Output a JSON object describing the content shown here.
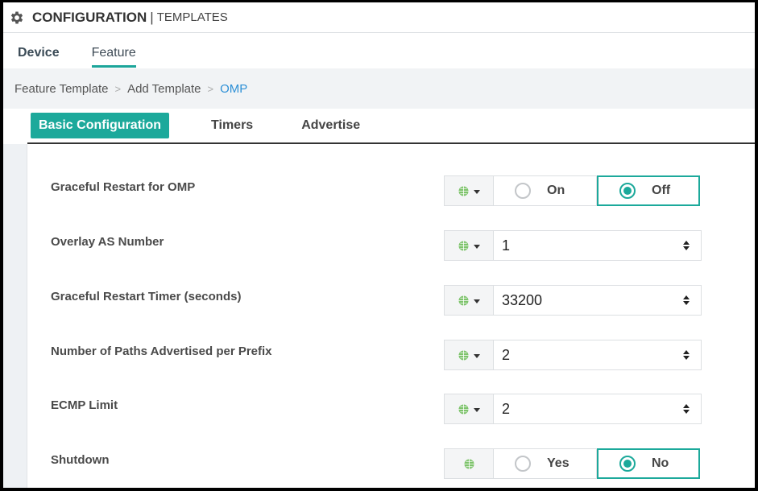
{
  "header": {
    "title": "CONFIGURATION",
    "separator": "|",
    "subtitle": "TEMPLATES",
    "icon": "gear-icon"
  },
  "nav": {
    "tabs": [
      {
        "label": "Device",
        "active": false
      },
      {
        "label": "Feature",
        "active": true
      }
    ]
  },
  "breadcrumb": {
    "items": [
      "Feature Template",
      "Add Template",
      "OMP"
    ],
    "separator": ">"
  },
  "subtabs": [
    {
      "label": "Basic Configuration",
      "active": true
    },
    {
      "label": "Timers",
      "active": false
    },
    {
      "label": "Advertise",
      "active": false
    }
  ],
  "colors": {
    "accent": "#1ca99b",
    "link": "#2c8fd6",
    "globe": "#7dc36b"
  },
  "form": {
    "rows": [
      {
        "label": "Graceful Restart for OMP",
        "type": "radio",
        "options": [
          "On",
          "Off"
        ],
        "selected": "Off",
        "scope_icon": "globe-icon",
        "has_dropdown": true
      },
      {
        "label": "Overlay AS Number",
        "type": "number",
        "value": "1",
        "scope_icon": "globe-icon",
        "has_dropdown": true
      },
      {
        "label": "Graceful Restart Timer (seconds)",
        "type": "number",
        "value": "33200",
        "scope_icon": "globe-icon",
        "has_dropdown": true
      },
      {
        "label": "Number of Paths Advertised per Prefix",
        "type": "number",
        "value": "2",
        "scope_icon": "globe-icon",
        "has_dropdown": true
      },
      {
        "label": "ECMP Limit",
        "type": "number",
        "value": "2",
        "scope_icon": "globe-icon",
        "has_dropdown": true
      },
      {
        "label": "Shutdown",
        "type": "radio",
        "options": [
          "Yes",
          "No"
        ],
        "selected": "No",
        "scope_icon": "globe-icon",
        "has_dropdown": false
      }
    ]
  }
}
